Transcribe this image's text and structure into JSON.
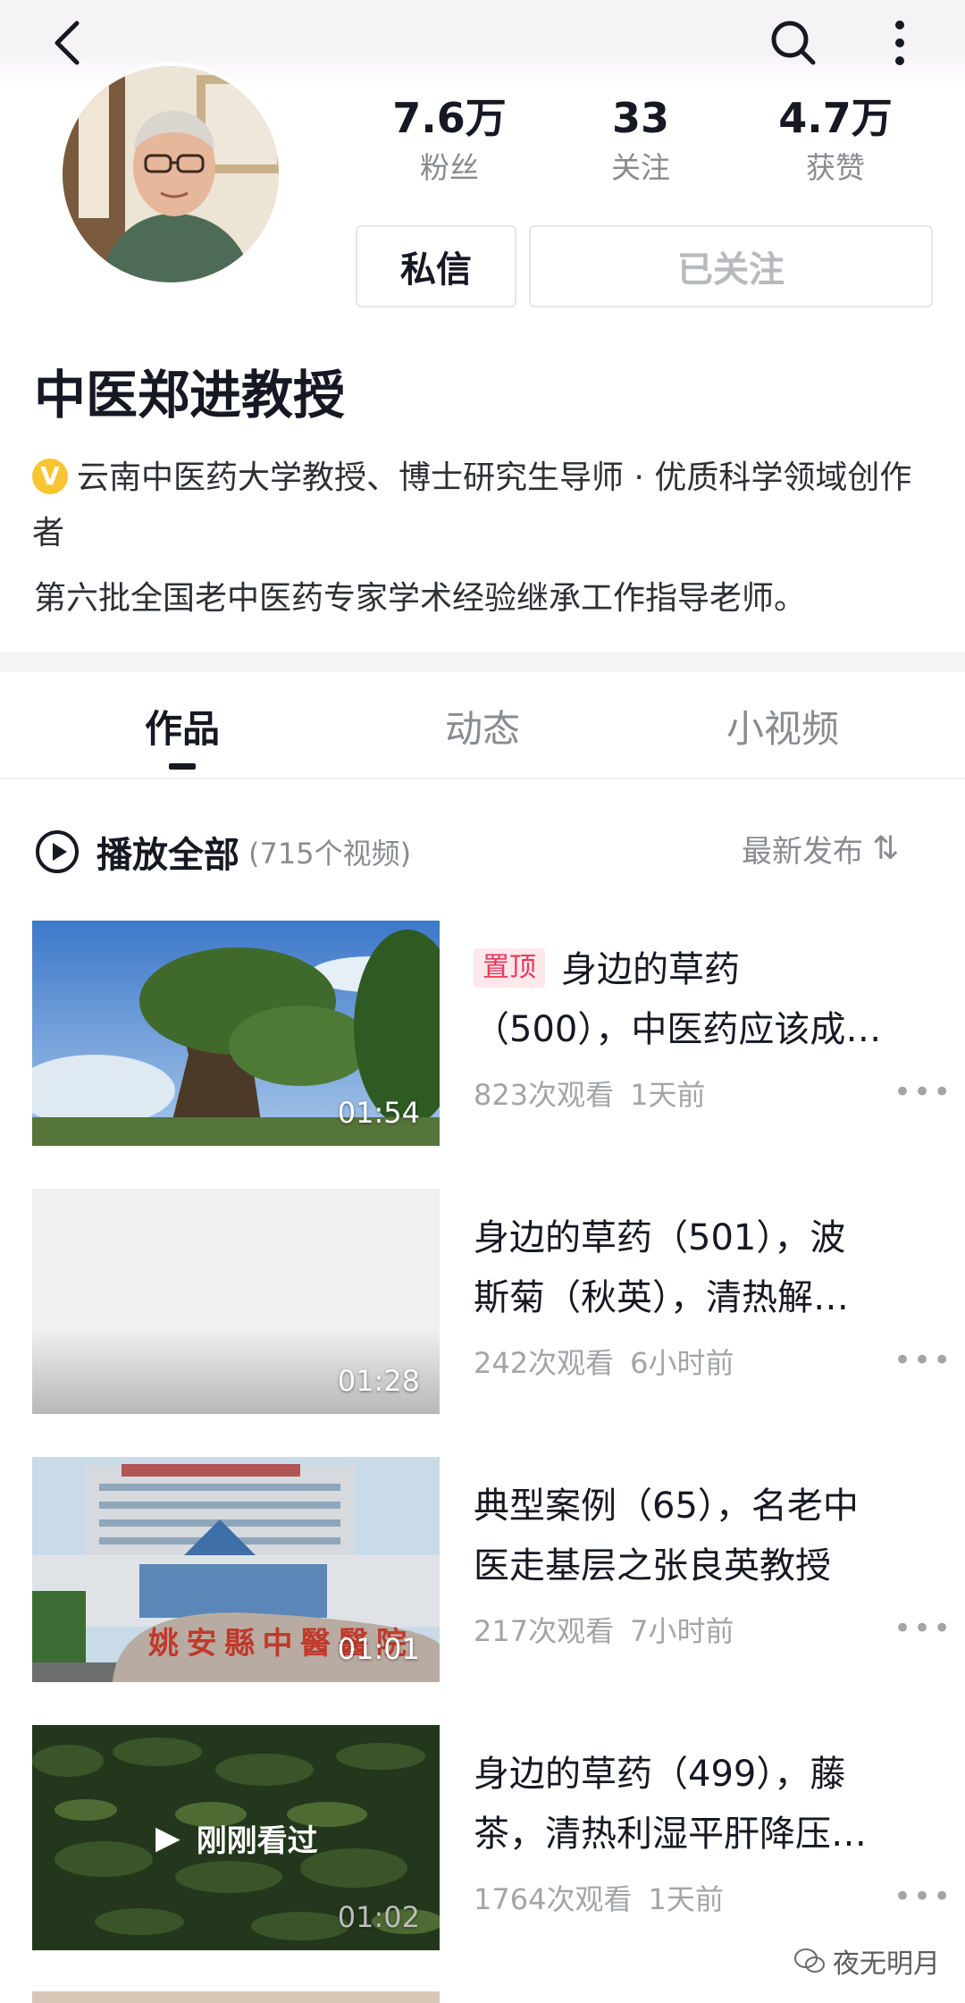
{
  "header": {
    "back_icon": "back-arrow-icon",
    "search_icon": "search-icon",
    "more_icon": "more-vertical-icon"
  },
  "profile": {
    "avatar": "avatar-photo",
    "stats": [
      {
        "value": "7.6万",
        "label": "粉丝"
      },
      {
        "value": "33",
        "label": "关注"
      },
      {
        "value": "4.7万",
        "label": "获赞"
      }
    ],
    "message_label": "私信",
    "follow_label": "已关注",
    "name": "中医郑进教授",
    "verify_badge": "V",
    "verify_text": "云南中医药大学教授、博士研究生导师 · 优质科学领域创作者",
    "bio": "第六批全国老中医药专家学术经验继承工作指导老师。"
  },
  "tabs": [
    {
      "label": "作品",
      "active": true
    },
    {
      "label": "动态",
      "active": false
    },
    {
      "label": "小视频",
      "active": false
    }
  ],
  "list_header": {
    "play_all": "播放全部",
    "count": "(715个视频)",
    "sort_label": "最新发布",
    "sort_icon": "⇅"
  },
  "videos": [
    {
      "pin": "置顶",
      "title_line1": "身边的草药",
      "title_line2": "（500），中医药应该成…",
      "views": "823次观看",
      "time": "1天前",
      "duration": "01:54"
    },
    {
      "title_line1": "身边的草药（501），波",
      "title_line2": "斯菊（秋英），清热解…",
      "views": "242次观看",
      "time": "6小时前",
      "duration": "01:28"
    },
    {
      "title_line1": "典型案例（65），名老中",
      "title_line2": "医走基层之张良英教授",
      "views": "217次观看",
      "time": "7小时前",
      "duration": "01:01"
    },
    {
      "title_line1": "身边的草药（499），藤",
      "title_line2": "茶，清热利湿平肝降压…",
      "views": "1764次观看",
      "time": "1天前",
      "duration": "01:02",
      "watched": "刚刚看过"
    }
  ],
  "more_dots": "•••",
  "watermark": "夜无明月",
  "colors": {
    "pin_bg": "#fde8ec",
    "pin_text": "#e9385a",
    "verify_badge": "#f7c531",
    "muted": "#8a8b91"
  }
}
